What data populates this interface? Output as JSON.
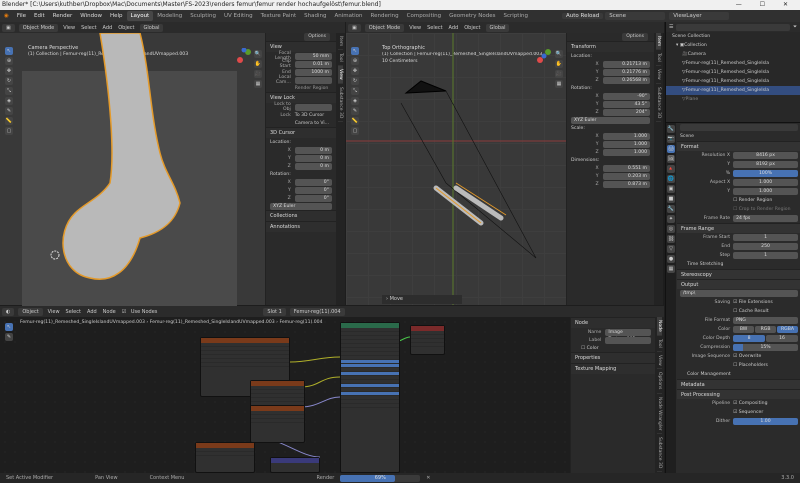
{
  "window_title": "Blender* [C:\\Users\\kuthber\\Dropbox\\Mac\\Documents\\Master\\FS-2023\\renders femur\\femur render hochaufgelöst\\femur.blend]",
  "menus": [
    "File",
    "Edit",
    "Render",
    "Window",
    "Help"
  ],
  "workspaces": [
    "Layout",
    "Modeling",
    "Sculpting",
    "UV Editing",
    "Texture Paint",
    "Shading",
    "Animation",
    "Rendering",
    "Compositing",
    "Geometry Nodes",
    "Scripting"
  ],
  "active_workspace": "Layout",
  "auto_reload": "Auto Reload",
  "scene": "Scene",
  "viewlayer": "ViewLayer",
  "viewport_left": {
    "mode": "Object Mode",
    "view": "View",
    "select": "Select",
    "add": "Add",
    "object": "Object",
    "orientation": "Global",
    "camera_label": "Camera Perspective",
    "collection_label": "(1) Collection | Femur-reg(11)_Remeshed_SingleIslandUVmapped.003",
    "options": "Options",
    "tabs": [
      "Item",
      "Tool",
      "View",
      "Substance 3D"
    ],
    "npanel": {
      "view_title": "View",
      "focal_length_label": "Focal Length",
      "focal_length": "50 mm",
      "clip_start_label": "Clip Start",
      "clip_start": "0.01 m",
      "end_label": "End",
      "end": "1000 m",
      "local_camera_label": "Local Cam...",
      "render_region": "Render Region",
      "view_lock_title": "View Lock",
      "lock_to_obj": "Lock to Obj",
      "lock_label": "Lock",
      "to_3d_cursor": "To 3D Cursor",
      "camera_to_view": "Camera to Vi...",
      "cursor_title": "3D Cursor",
      "location_label": "Location:",
      "x_label": "X",
      "y_label": "Y",
      "z_label": "Z",
      "cx": "0 m",
      "cy": "0 m",
      "cz": "0 m",
      "rotation_label": "Rotation:",
      "rx": "0°",
      "ry": "0°",
      "rz": "0°",
      "rot_mode": "XYZ Euler",
      "collections": "Collections",
      "annotations": "Annotations"
    }
  },
  "viewport_right": {
    "mode": "Object Mode",
    "view": "View",
    "select": "Select",
    "add": "Add",
    "object": "Object",
    "orientation": "Global",
    "ortho_label": "Top Orthographic",
    "collection_label": "(1) Collection | Femur-reg(11)_Remeshed_SingleIslandUVmapped.003",
    "scale_label": "10 Centimeters",
    "options": "Options",
    "move_label": "Move",
    "tabs": [
      "Item",
      "Tool",
      "View",
      "Substance 3D"
    ],
    "transform": {
      "title": "Transform",
      "location_label": "Location:",
      "x_label": "X",
      "y_label": "Y",
      "z_label": "Z",
      "lx": "0.21713 m",
      "ly": "0.21776 m",
      "lz": "0.26568 m",
      "rotation_label": "Rotation:",
      "rx": "-90°",
      "ry": "43.5°",
      "rz": "204°",
      "rot_mode": "XYZ Euler",
      "scale_label": "Scale:",
      "sx": "1.000",
      "sy": "1.000",
      "sz": "1.000",
      "dimensions_label": "Dimensions:",
      "dx": "0.551 m",
      "dy": "0.203 m",
      "dz": "0.873 m"
    }
  },
  "outliner": {
    "title": "Scene Collection",
    "items": [
      "Collection",
      "Camera",
      "Femur-reg(11)_Remeshed_SingleIsla",
      "Femur-reg(11)_Remeshed_SingleIsla",
      "Femur-reg(11)_Remeshed_SingleIsla",
      "Femur-reg(11)_Remeshed_SingleIsla",
      "Plane"
    ],
    "selected_index": 5
  },
  "properties": {
    "scene": "Scene",
    "format_title": "Format",
    "resolution_x_label": "Resolution X",
    "resolution_x": "8416 px",
    "y_label": "Y",
    "resolution_y": "8192 px",
    "pct_label": "%",
    "pct": "100%",
    "aspect_x_label": "Aspect X",
    "aspect_x": "1.000",
    "aspect_y": "1.000",
    "render_region": "Render Region",
    "crop_region": "Crop to Render Region",
    "frame_rate_label": "Frame Rate",
    "frame_rate": "24 fps",
    "frame_range_title": "Frame Range",
    "frame_start_label": "Frame Start",
    "frame_start": "1",
    "end_label": "End",
    "frame_end": "250",
    "step_label": "Step",
    "step": "1",
    "time_stretching": "Time Stretching",
    "stereoscopy": "Stereoscopy",
    "output_title": "Output",
    "output_path": "/tmp\\",
    "saving_label": "Saving",
    "file_extensions": "File Extensions",
    "cache_result": "Cache Result",
    "file_format_label": "File Format",
    "file_format": "PNG",
    "color_label": "Color",
    "color_options": [
      "BW",
      "RGB",
      "RGBA"
    ],
    "color_selected": "RGBA",
    "color_depth_label": "Color Depth",
    "color_depth_options": [
      "8",
      "16"
    ],
    "color_depth_selected": "8",
    "compression_label": "Compression",
    "compression": "15%",
    "compression_fraction": 0.15,
    "image_sequence_label": "Image Sequence",
    "overwrite": "Overwrite",
    "placeholders": "Placeholders",
    "color_management": "Color Management",
    "metadata": "Metadata",
    "post_processing": "Post Processing",
    "pipeline_label": "Pipeline",
    "compositing": "Compositing",
    "sequencer": "Sequencer",
    "dither_label": "Dither",
    "dither": "1.00"
  },
  "node_editor": {
    "type": "Object",
    "view": "View",
    "select": "Select",
    "add": "Add",
    "node": "Node",
    "use_nodes": "Use Nodes",
    "slot": "Slot 1",
    "material": "Femur-reg(11).004",
    "breadcrumb": [
      "Femur-reg(11)_Remeshed_SingleIslandUVmapped.003",
      "Femur-reg(11)_Remeshed_SingleIslandUVmapped.003",
      "Femur-reg(11).004"
    ],
    "side": {
      "title": "Node",
      "name_label": "Name",
      "name": "Image Texture.002",
      "label_label": "Label",
      "color": "Color",
      "properties": "Properties",
      "texture_mapping": "Texture Mapping"
    },
    "tabs": [
      "Node",
      "Tool",
      "View",
      "Options",
      "Node Wrangler",
      "Substance 3D"
    ]
  },
  "statusbar": {
    "left": "Set Active Modifier",
    "mid1": "Pan View",
    "mid2": "Context Menu",
    "render": "Render",
    "progress": "69%",
    "progress_fraction": 0.69,
    "version": "3.3.0"
  }
}
